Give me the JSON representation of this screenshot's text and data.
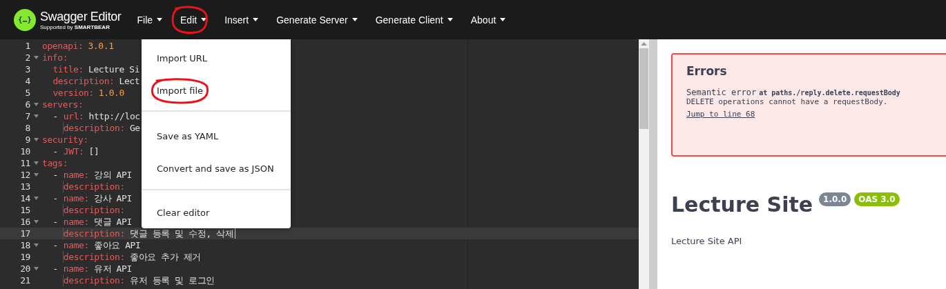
{
  "header": {
    "logo": {
      "mark": "{…}",
      "title": "Swagger Editor",
      "subtitle": "Supported by **SMARTBEAR**"
    },
    "nav": [
      {
        "label": "File",
        "circled": false
      },
      {
        "label": "Edit",
        "circled": true
      },
      {
        "label": "Insert",
        "circled": false
      },
      {
        "label": "Generate Server",
        "circled": false
      },
      {
        "label": "Generate Client",
        "circled": false
      },
      {
        "label": "About",
        "circled": false
      }
    ]
  },
  "editor": {
    "lines": [
      {
        "number": "1",
        "key": "openapi:",
        "value": "3.0.1",
        "kind": "number",
        "current": false
      },
      {
        "number": "2",
        "key": "info:",
        "expanded": true,
        "current": false,
        "children": [
          {
            "number": "3",
            "key": "title:",
            "value": "Lecture Si",
            "kind": "string",
            "current": false
          },
          {
            "number": "4",
            "key": "description:",
            "value": "Lect",
            "kind": "string",
            "current": false
          },
          {
            "number": "5",
            "key": "version:",
            "value": "1.0.0",
            "kind": "number",
            "current": false
          }
        ]
      },
      {
        "number": "6",
        "key": "servers:",
        "expanded": true,
        "current": false,
        "children": [
          {
            "number": "7",
            "bullet": "-",
            "key": "url:",
            "value": "http://loc",
            "kind": "string",
            "expanded": true,
            "current": false,
            "children": [
              {
                "number": "8",
                "key": "description:",
                "value": "Ge",
                "kind": "string",
                "current": false
              }
            ]
          }
        ]
      },
      {
        "number": "9",
        "key": "security:",
        "expanded": true,
        "current": false,
        "children": [
          {
            "number": "10",
            "bullet": "-",
            "key": "JWT:",
            "value": "[]",
            "kind": "string",
            "current": false
          }
        ]
      },
      {
        "number": "11",
        "key": "tags:",
        "expanded": true,
        "current": false,
        "children": [
          {
            "number": "12",
            "bullet": "-",
            "key": "name:",
            "value": "강의 API",
            "kind": "string",
            "expanded": true,
            "current": false,
            "children": [
              {
                "number": "13",
                "key": "description:",
                "current": false
              }
            ]
          },
          {
            "number": "14",
            "bullet": "-",
            "key": "name:",
            "value": "강사 API",
            "kind": "string",
            "expanded": true,
            "current": false,
            "children": [
              {
                "number": "15",
                "key": "description:",
                "current": false
              }
            ]
          },
          {
            "number": "16",
            "bullet": "-",
            "key": "name:",
            "value": "댓글 API",
            "kind": "string",
            "expanded": true,
            "current": false,
            "children": [
              {
                "number": "17",
                "key": "description:",
                "value": "댓글 등록 및 수정, 삭제",
                "kind": "string",
                "current": true
              }
            ]
          },
          {
            "number": "18",
            "bullet": "-",
            "key": "name:",
            "value": "좋아요 API",
            "kind": "string",
            "expanded": true,
            "current": false,
            "children": [
              {
                "number": "19",
                "key": "description:",
                "value": "좋아요 추가 제거",
                "kind": "string",
                "current": false
              }
            ]
          },
          {
            "number": "20",
            "bullet": "-",
            "key": "name:",
            "value": "유저 API",
            "kind": "string",
            "expanded": true,
            "current": false,
            "children": [
              {
                "number": "21",
                "key": "description:",
                "value": "유저 등록 및 로그인",
                "kind": "string",
                "current": false
              }
            ]
          }
        ]
      }
    ]
  },
  "menu": {
    "groups": [
      [
        {
          "label": "Import URL",
          "circled": false
        },
        {
          "label": "Import file",
          "circled": true
        }
      ],
      [
        {
          "label": "Save as YAML",
          "circled": false
        },
        {
          "label": "Convert and save as JSON",
          "circled": false
        }
      ],
      [
        {
          "label": "Clear editor",
          "circled": false
        }
      ]
    ]
  },
  "errors": {
    "title": "Errors",
    "items": [
      {
        "type": "Semantic error",
        "location": "at paths./reply.delete.requestBody",
        "message": "DELETE operations cannot have a requestBody.",
        "link": "Jump to line 68"
      }
    ]
  },
  "info": {
    "title": "Lecture Site",
    "version": "1.0.0",
    "oas": "OAS 3.0",
    "description": "Lecture Site API"
  }
}
